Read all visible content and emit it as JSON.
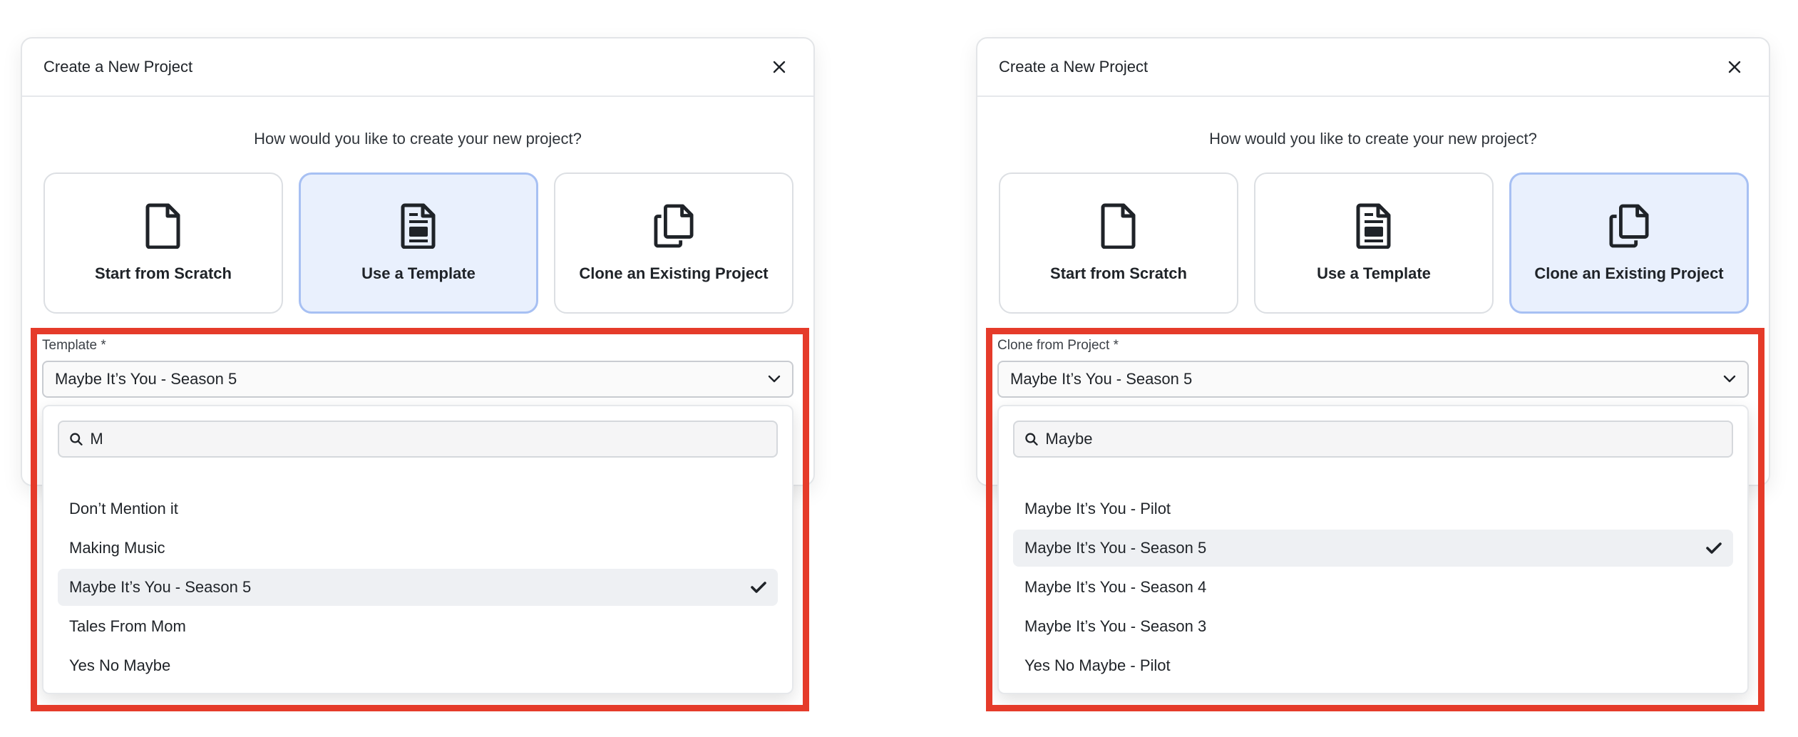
{
  "panels": [
    {
      "modal_title": "Create a New Project",
      "question": "How would you like to create your new project?",
      "cards": [
        {
          "label": "Start from Scratch",
          "icon": "file-icon"
        },
        {
          "label": "Use a Template",
          "icon": "template-icon",
          "selected": true
        },
        {
          "label": "Clone an Existing Project",
          "icon": "copy-icon"
        }
      ],
      "field_label": "Template *",
      "selected_value": "Maybe It’s You - Season 5",
      "search_value": "M",
      "options": [
        {
          "label": "Don’t Mention it"
        },
        {
          "label": "Making Music"
        },
        {
          "label": "Maybe It’s You - Season 5",
          "selected": true
        },
        {
          "label": "Tales From Mom"
        },
        {
          "label": "Yes No Maybe"
        }
      ]
    },
    {
      "modal_title": "Create a New Project",
      "question": "How would you like to create your new project?",
      "cards": [
        {
          "label": "Start from Scratch",
          "icon": "file-icon"
        },
        {
          "label": "Use a Template",
          "icon": "template-icon"
        },
        {
          "label": "Clone an Existing Project",
          "icon": "copy-icon",
          "selected": true
        }
      ],
      "field_label": "Clone from Project *",
      "selected_value": "Maybe It’s You - Season 5",
      "search_value": "Maybe",
      "options": [
        {
          "label": "Maybe It’s You - Pilot"
        },
        {
          "label": "Maybe It’s You - Season 5",
          "selected": true
        },
        {
          "label": "Maybe It’s You - Season 4"
        },
        {
          "label": "Maybe It’s You - Season 3"
        },
        {
          "label": "Yes No Maybe - Pilot"
        }
      ]
    }
  ],
  "colors": {
    "accent_bg": "#e9f0fd",
    "accent_border": "#a7c0f3",
    "highlight": "#e53b2a"
  }
}
